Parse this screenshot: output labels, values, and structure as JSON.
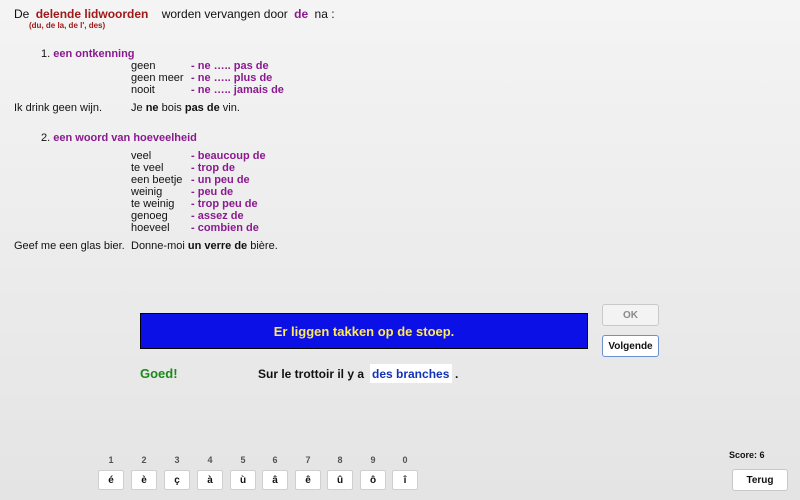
{
  "intro": {
    "prefix": "De",
    "term": "delende lidwoorden",
    "middle": "worden vervangen door",
    "de_word": "de",
    "suffix": "na :",
    "sub": "(du, de la, de l', des)"
  },
  "section1": {
    "title_num": "1.",
    "title": "een ontkenning",
    "rows": [
      {
        "nl": "geen",
        "fr": "- ne ….. pas de"
      },
      {
        "nl": "geen meer",
        "fr": "- ne ….. plus de"
      },
      {
        "nl": "nooit",
        "fr": "- ne ….. jamais de"
      }
    ],
    "example": {
      "nl": "Ik drink geen wijn.",
      "fr_a": "Je",
      "fr_b": "ne",
      "fr_c": "bois",
      "fr_d": "pas de",
      "fr_e": "vin."
    }
  },
  "section2": {
    "title_num": "2.",
    "title": "een woord van hoeveelheid",
    "rows": [
      {
        "nl": "veel",
        "fr": "- beaucoup de"
      },
      {
        "nl": "te veel",
        "fr": "- trop de"
      },
      {
        "nl": "een beetje",
        "fr": "- un peu de"
      },
      {
        "nl": "weinig",
        "fr": "- peu de"
      },
      {
        "nl": "te weinig",
        "fr": "- trop peu de"
      },
      {
        "nl": "genoeg",
        "fr": "- assez de"
      },
      {
        "nl": "hoeveel",
        "fr": "- combien de"
      }
    ],
    "example": {
      "nl": "Geef me een glas bier.",
      "fr_a": "Donne-moi",
      "fr_b": "un verre de",
      "fr_c": "bière."
    }
  },
  "exercise": {
    "prompt": "Er liggen takken op de stoep.",
    "feedback": "Goed!",
    "sentence_start": "Sur le trottoir il y a",
    "answer": "des branches",
    "sentence_end": "."
  },
  "buttons": {
    "ok": "OK",
    "next": "Volgende",
    "back": "Terug"
  },
  "score": "Score: 6",
  "keys": [
    {
      "num": "1",
      "char": "é"
    },
    {
      "num": "2",
      "char": "è"
    },
    {
      "num": "3",
      "char": "ç"
    },
    {
      "num": "4",
      "char": "à"
    },
    {
      "num": "5",
      "char": "ù"
    },
    {
      "num": "6",
      "char": "â"
    },
    {
      "num": "7",
      "char": "ê"
    },
    {
      "num": "8",
      "char": "û"
    },
    {
      "num": "9",
      "char": "ô"
    },
    {
      "num": "0",
      "char": "î"
    }
  ],
  "colors": {
    "prompt_bg": "#0b10e6",
    "prompt_text": "#ffe95c",
    "feedback": "#1a8a1a",
    "answer": "#1232b8",
    "accent": "#8a1a8f"
  }
}
